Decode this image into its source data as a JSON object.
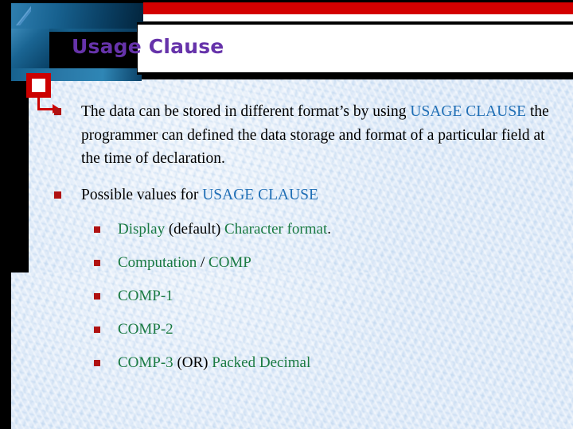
{
  "slide": {
    "title": "Usage Clause",
    "colors": {
      "title_text": "#6633aa",
      "accent_red": "#d40000",
      "marker_red": "#cc0000",
      "bullet_red": "#b01212",
      "emphasis_blue": "#1f6eb5",
      "emphasis_green": "#1a7a42",
      "background_paper": "#dde9f8",
      "decoration_blue": "#17618f"
    },
    "icons": {
      "marker": "red-square-callout-icon",
      "arrow": "elbow-arrow-right-icon",
      "bullet": "square-bullet-icon"
    },
    "body": [
      {
        "level": 1,
        "id": "bullet-usage-clause-intro",
        "runs": [
          {
            "text": "The data can be stored in different format’s  by using ",
            "style": "plain"
          },
          {
            "text": "USAGE CLAUSE",
            "style": "blue"
          },
          {
            "text": " the programmer can defined the data storage and format of a particular field at the time of declaration.",
            "style": "plain"
          }
        ]
      },
      {
        "level": 1,
        "id": "bullet-possible-values",
        "runs": [
          {
            "text": "Possible values for ",
            "style": "plain"
          },
          {
            "text": "USAGE CLAUSE",
            "style": "blue"
          }
        ]
      },
      {
        "level": 2,
        "id": "bullet-display",
        "runs": [
          {
            "text": "Display ",
            "style": "green"
          },
          {
            "text": "(default) ",
            "style": "plain"
          },
          {
            "text": "Character format",
            "style": "green"
          },
          {
            "text": ".",
            "style": "plain"
          }
        ]
      },
      {
        "level": 2,
        "id": "bullet-computation",
        "runs": [
          {
            "text": "Computation ",
            "style": "green"
          },
          {
            "text": "/ ",
            "style": "plain"
          },
          {
            "text": "COMP",
            "style": "green"
          }
        ]
      },
      {
        "level": 2,
        "id": "bullet-comp-1",
        "runs": [
          {
            "text": "COMP-1",
            "style": "green"
          }
        ]
      },
      {
        "level": 2,
        "id": "bullet-comp-2",
        "runs": [
          {
            "text": "COMP-2",
            "style": "green"
          }
        ]
      },
      {
        "level": 2,
        "id": "bullet-comp-3",
        "runs": [
          {
            "text": "COMP-3 ",
            "style": "green"
          },
          {
            "text": "(OR) ",
            "style": "plain"
          },
          {
            "text": "Packed Decimal",
            "style": "green"
          }
        ]
      }
    ]
  }
}
